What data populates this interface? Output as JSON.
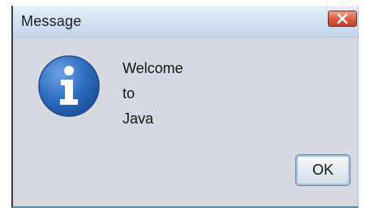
{
  "window": {
    "title": "Message",
    "close_icon": "close-icon"
  },
  "dialog": {
    "icon": "info-icon",
    "message_lines": [
      "Welcome",
      "to",
      "Java"
    ],
    "ok_label": "OK"
  },
  "colors": {
    "dialog_background": "#d6d9df",
    "close_button": "#d9593c",
    "info_icon": "#2f6fc2"
  }
}
